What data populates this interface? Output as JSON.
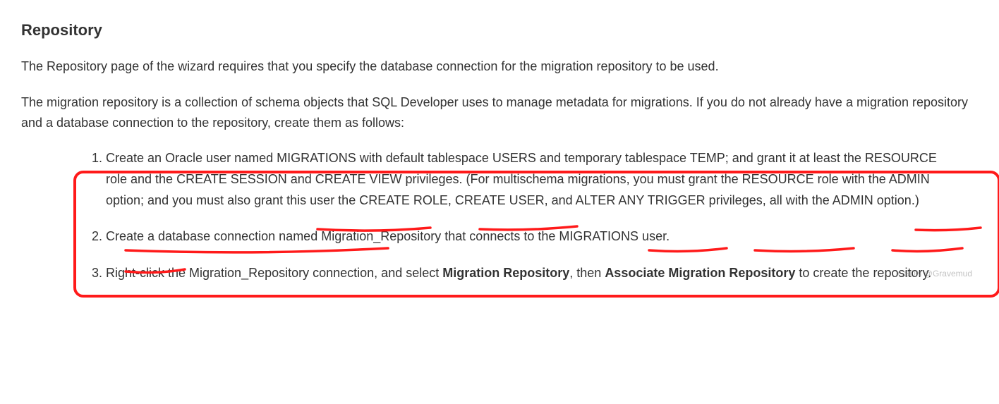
{
  "heading": "Repository",
  "para1": "The Repository page of the wizard requires that you specify the database connection for the migration repository to be used.",
  "para2": "The migration repository is a collection of schema objects that SQL Developer uses to manage metadata for migrations. If you do not already have a migration repository and a database connection to the repository, create them as follows:",
  "step1": "Create an Oracle user named MIGRATIONS with default tablespace USERS and temporary tablespace TEMP; and grant it at least the RESOURCE role and the CREATE SESSION and CREATE VIEW privileges. (For multischema migrations, you must grant the RESOURCE role with the ADMIN option; and you must also grant this user the CREATE ROLE, CREATE USER, and ALTER ANY TRIGGER privileges, all with the ADMIN option.)",
  "step2": "Create a database connection named Migration_Repository that connects to the MIGRATIONS user.",
  "step3_pre": "Right-click the Migration_Repository connection, and select ",
  "step3_b1": "Migration Repository",
  "step3_mid": ", then ",
  "step3_b2": "Associate Migration Repository",
  "step3_post": " to create the repository.",
  "watermark": "CSDN @Gravemud"
}
